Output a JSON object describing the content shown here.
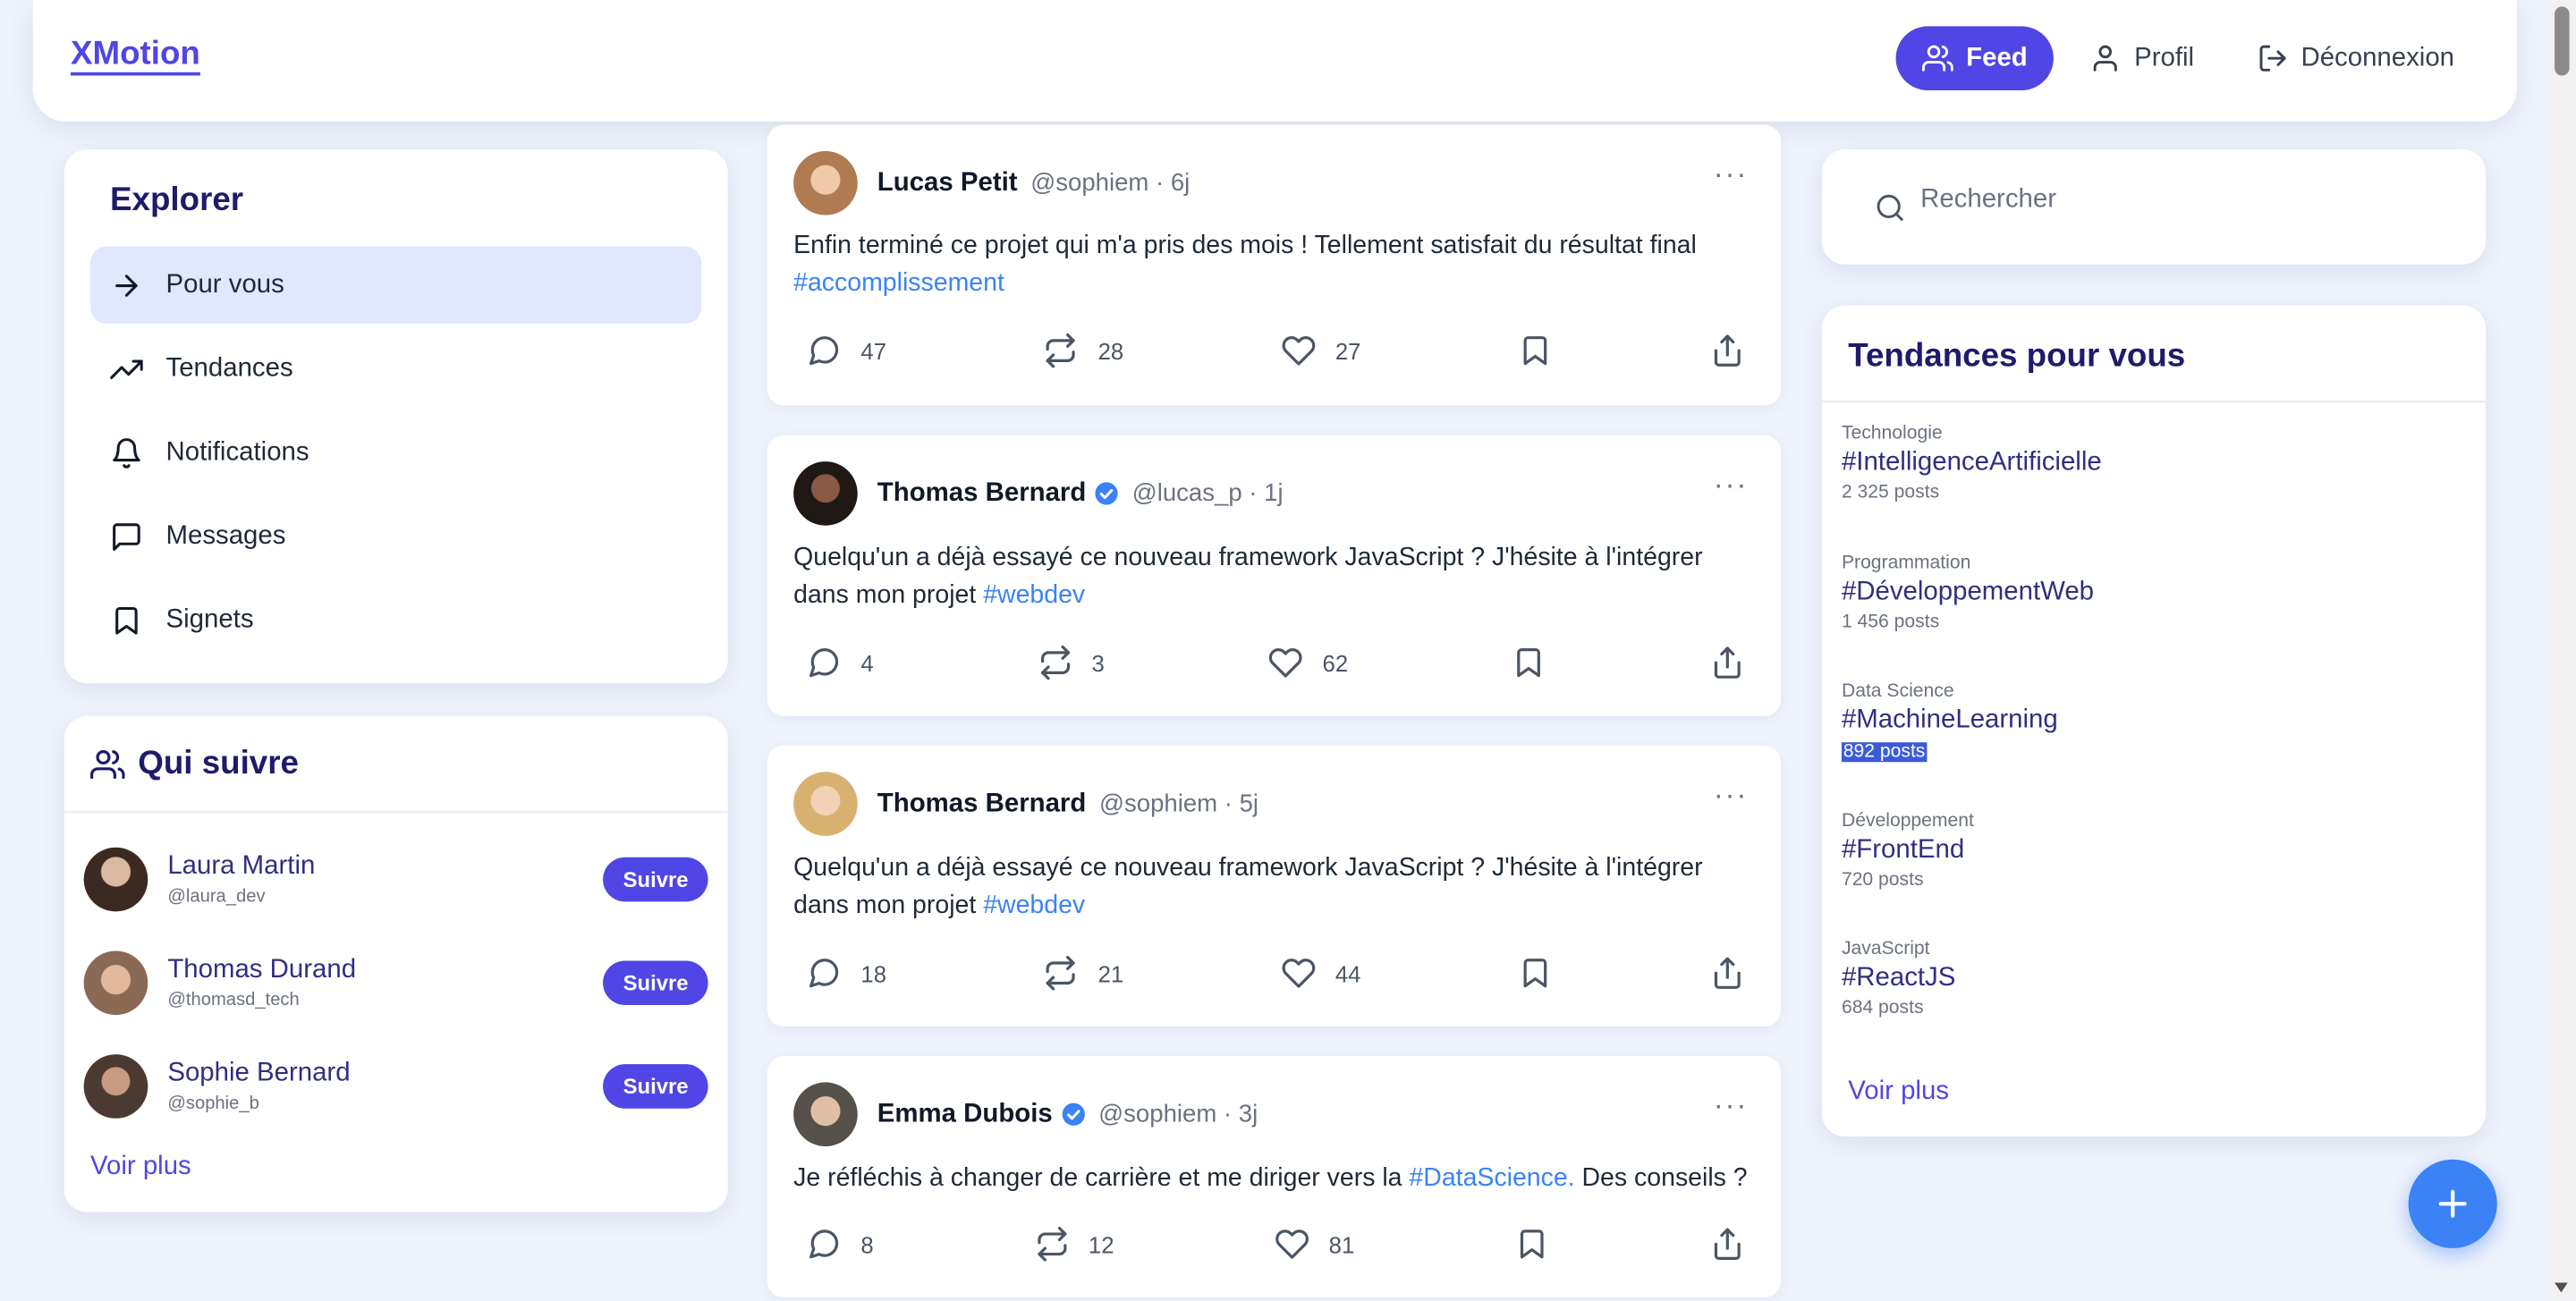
{
  "app": {
    "logo": "XMotion"
  },
  "nav": [
    {
      "label": "Feed",
      "icon": "users-icon",
      "active": true
    },
    {
      "label": "Profil",
      "icon": "user-icon"
    },
    {
      "label": "Déconnexion",
      "icon": "logout-icon"
    }
  ],
  "explorer": {
    "title": "Explorer",
    "items": [
      {
        "label": "Pour vous",
        "icon": "arrow-right-icon",
        "active": true
      },
      {
        "label": "Tendances",
        "icon": "trending-icon"
      },
      {
        "label": "Notifications",
        "icon": "bell-icon"
      },
      {
        "label": "Messages",
        "icon": "message-icon"
      },
      {
        "label": "Signets",
        "icon": "bookmark-icon"
      }
    ]
  },
  "who_to_follow": {
    "title": "Qui suivre",
    "follow_label": "Suivre",
    "more_label": "Voir plus",
    "users": [
      {
        "name": "Laura Martin",
        "handle": "@laura_dev",
        "avatar_color": "#5b4a3f"
      },
      {
        "name": "Thomas Durand",
        "handle": "@thomasd_tech",
        "avatar_color": "#b08770"
      },
      {
        "name": "Sophie Bernard",
        "handle": "@sophie_b",
        "avatar_color": "#6b5548"
      }
    ]
  },
  "posts": [
    {
      "name": "Lucas Petit",
      "verified": false,
      "meta": "@sophiem · 6j",
      "text": "Enfin terminé ce projet qui m'a pris des mois ! Tellement satisfait du résultat final ",
      "tag": "#accomplissement",
      "tail": "",
      "comments": "47",
      "reposts": "28",
      "likes": "27",
      "avatar_color": "#c9a27f"
    },
    {
      "name": "Thomas Bernard",
      "verified": true,
      "meta": "@lucas_p · 1j",
      "text": "Quelqu'un a déjà essayé ce nouveau framework JavaScript ? J'hésite à l'intégrer dans mon projet ",
      "tag": "#webdev",
      "tail": "",
      "comments": "4",
      "reposts": "3",
      "likes": "62",
      "avatar_color": "#3a2e2a"
    },
    {
      "name": "Thomas Bernard",
      "verified": false,
      "meta": "@sophiem · 5j",
      "text": "Quelqu'un a déjà essayé ce nouveau framework JavaScript ? J'hésite à l'intégrer dans mon projet ",
      "tag": "#webdev",
      "tail": "",
      "comments": "18",
      "reposts": "21",
      "likes": "44",
      "avatar_color": "#d9b48c"
    },
    {
      "name": "Emma Dubois",
      "verified": true,
      "meta": "@sophiem · 3j",
      "text": "Je réfléchis à changer de carrière et me diriger vers la ",
      "tag": "#DataScience.",
      "tail": " Des conseils ?",
      "comments": "8",
      "reposts": "12",
      "likes": "81",
      "avatar_color": "#6f6a63"
    }
  ],
  "search": {
    "placeholder": "Rechercher"
  },
  "trends": {
    "title": "Tendances pour vous",
    "more_label": "Voir plus",
    "items": [
      {
        "category": "Technologie",
        "tag": "#IntelligenceArtificielle",
        "count": "2 325 posts"
      },
      {
        "category": "Programmation",
        "tag": "#DéveloppementWeb",
        "count": "1 456 posts"
      },
      {
        "category": "Data Science",
        "tag": "#MachineLearning",
        "count": "892 posts",
        "selected": true
      },
      {
        "category": "Développement",
        "tag": "#FrontEnd",
        "count": "720 posts"
      },
      {
        "category": "JavaScript",
        "tag": "#ReactJS",
        "count": "684 posts"
      }
    ]
  },
  "colors": {
    "accent": "#4f46e5",
    "link": "#3b82f6",
    "title": "#1e1b6b",
    "background": "#eef2fb"
  }
}
